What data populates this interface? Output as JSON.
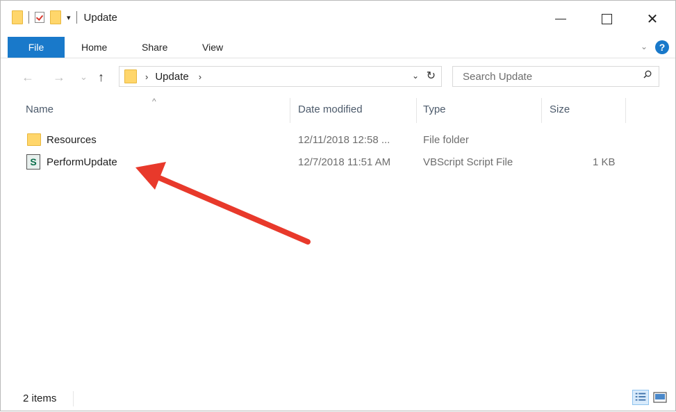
{
  "titlebar": {
    "title": "Update",
    "quick_access_arrow": "▾",
    "min_symbol": "",
    "close_symbol": "✕"
  },
  "ribbon": {
    "tabs": [
      "File",
      "Home",
      "Share",
      "View"
    ],
    "help_symbol": "?"
  },
  "nav": {
    "back_symbol": "←",
    "forward_symbol": "→",
    "recent_symbol": "⌄",
    "up_symbol": "↑",
    "breadcrumb": [
      "Update"
    ],
    "search_placeholder": "Search Update"
  },
  "columns": [
    "Name",
    "Date modified",
    "Type",
    "Size"
  ],
  "files": [
    {
      "name": "Resources",
      "date": "12/11/2018 12:58 ...",
      "type": "File folder",
      "size": "",
      "icon": "folder-icon"
    },
    {
      "name": "PerformUpdate",
      "date": "12/7/2018 11:51 AM",
      "type": "VBScript Script File",
      "size": "1 KB",
      "icon": "vbscript-file-icon"
    }
  ],
  "status": {
    "item_count": "2 items"
  },
  "colors": {
    "accent": "#1979ca",
    "annotation_arrow": "#e8392b",
    "folder": "#ffd66b"
  }
}
